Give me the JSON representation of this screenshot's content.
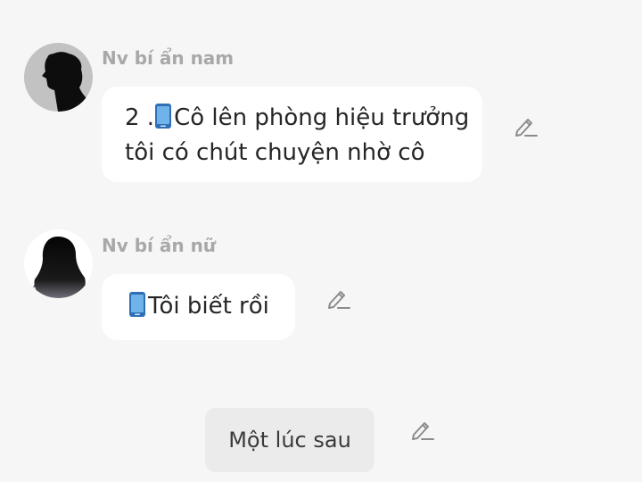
{
  "messages": [
    {
      "sender": "Nv bí ẩn nam",
      "avatar": "male-silhouette-avatar",
      "text_lines": [
        "2 .",
        "Cô lên phòng hiệu trưởng",
        "tôi có chút chuyện nhờ cô"
      ],
      "emoji": "mobile-phone-icon",
      "edit_icon": "pencil-icon"
    },
    {
      "sender": "Nv bí ẩn nữ",
      "avatar": "female-silhouette-avatar",
      "text_lines": [
        "Tôi biết rồi"
      ],
      "emoji": "mobile-phone-icon",
      "edit_icon": "pencil-icon"
    }
  ],
  "choice": {
    "label": "Một lúc sau",
    "edit_icon": "pencil-icon"
  },
  "colors": {
    "background": "#f6f6f6",
    "bubble": "#ffffff",
    "sender_name": "#a8a8a8",
    "message_text": "#262626",
    "choice_button": "#ebebeb",
    "phone_emoji": "#5b9bd5"
  }
}
